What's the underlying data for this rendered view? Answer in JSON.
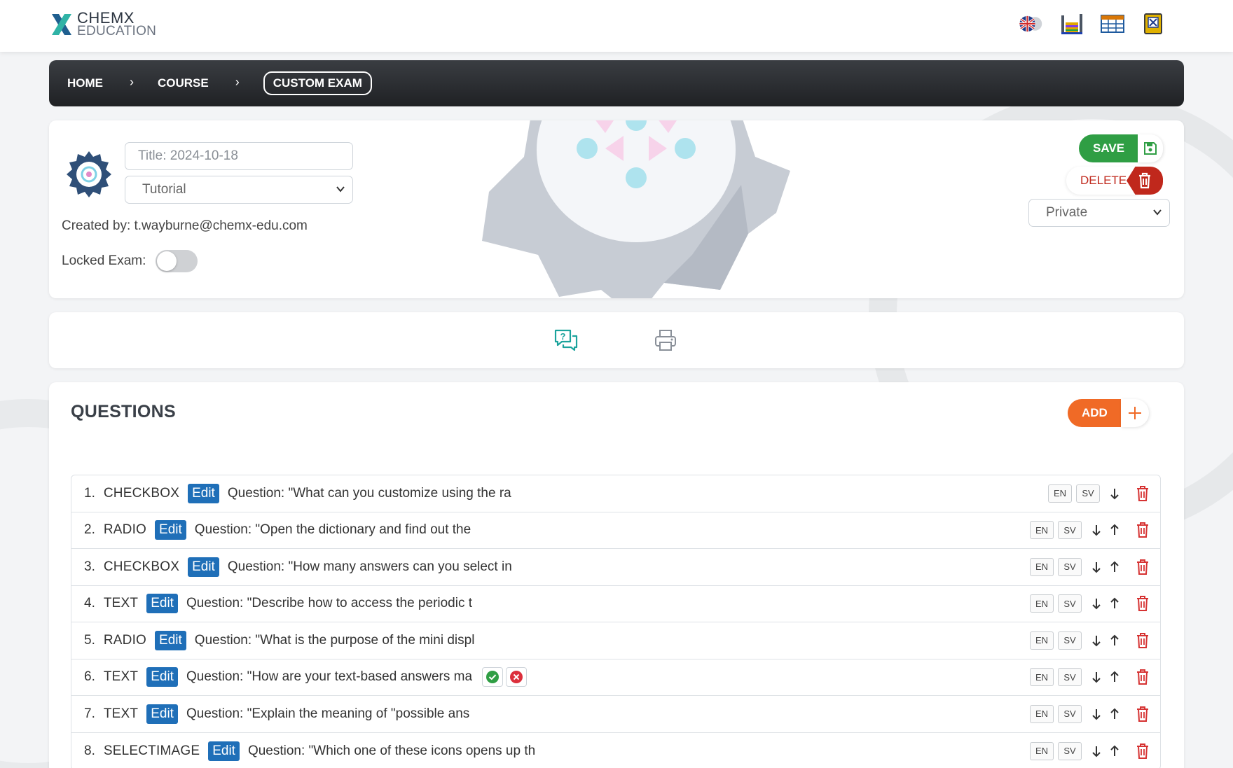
{
  "brand": {
    "line1": "CHEMX",
    "line2": "EDUCATION"
  },
  "top_icons": [
    "language-flag-icon",
    "periodic-table-icon",
    "table-grid-icon",
    "book-icon"
  ],
  "breadcrumb": {
    "items": [
      "HOME",
      "COURSE",
      "CUSTOM EXAM"
    ]
  },
  "exam": {
    "title_placeholder": "Title: 2024-10-18",
    "type_value": "Tutorial",
    "created_by": "Created by: t.wayburne@chemx-edu.com",
    "locked_label": "Locked Exam:",
    "locked": false,
    "save_label": "SAVE",
    "delete_label": "DELETE",
    "visibility_value": "Private"
  },
  "tools": [
    "questions-icon",
    "print-icon"
  ],
  "questions_section": {
    "heading": "QUESTIONS",
    "add_label": "ADD",
    "rows": [
      {
        "num": "1.",
        "type": "CHECKBOX",
        "edit": "Edit",
        "text": "Question: \"What can you customize using the ra"
      },
      {
        "num": "2.",
        "type": "RADIO",
        "edit": "Edit",
        "text": "Question: \"Open the dictionary and find out the"
      },
      {
        "num": "3.",
        "type": "CHECKBOX",
        "edit": "Edit",
        "text": "Question: \"How many answers can you select in"
      },
      {
        "num": "4.",
        "type": "TEXT",
        "edit": "Edit",
        "text": "Question: \"Describe how to access the periodic t"
      },
      {
        "num": "5.",
        "type": "RADIO",
        "edit": "Edit",
        "text": "Question: \"What is the purpose of the mini displ"
      },
      {
        "num": "6.",
        "type": "TEXT",
        "edit": "Edit",
        "text": "Question: \"How are your text-based answers ma"
      },
      {
        "num": "7.",
        "type": "TEXT",
        "edit": "Edit",
        "text": "Question: \"Explain the meaning of \"possible ans"
      },
      {
        "num": "8.",
        "type": "SELECTIMAGE",
        "edit": "Edit",
        "text": "Question: \"Which one of these icons opens up th"
      }
    ],
    "lang_en": "EN",
    "lang_sv": "SV"
  },
  "colors": {
    "save": "#2f9e44",
    "delete": "#c0281c",
    "add": "#f06a26",
    "edit": "#1f6fb8",
    "breadcrumb": "#2a2c30"
  }
}
